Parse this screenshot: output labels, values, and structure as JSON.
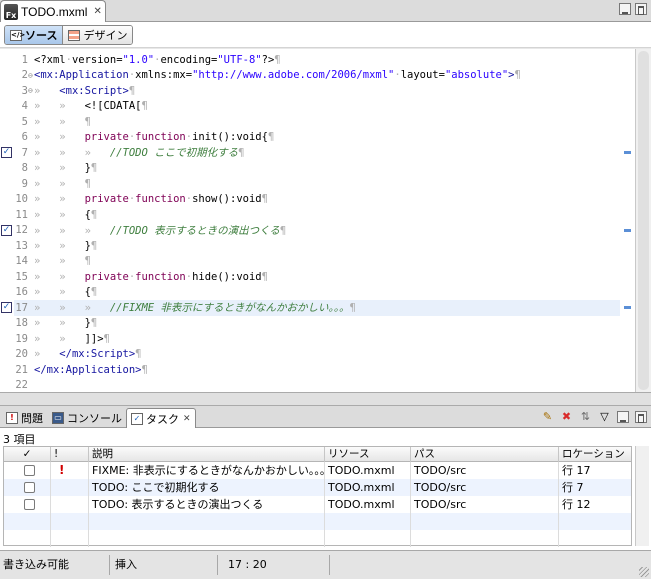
{
  "editor_tab": {
    "title": "TODO.mxml",
    "icon": "flex-file-icon"
  },
  "mode_bar": {
    "source_label": "ソース",
    "design_label": "デザイン",
    "active": "source"
  },
  "code_lines": [
    {
      "n": "1",
      "fold": "",
      "html": "<span class=\"pl\">&lt;?xml</span><span class=\"ws\">·</span><span class=\"pl\">version=</span><span class=\"str\">\"1.0\"</span><span class=\"ws\">·</span><span class=\"pl\">encoding=</span><span class=\"str\">\"UTF-8\"</span><span class=\"pl\">?&gt;</span><span class=\"ws\">¶</span>"
    },
    {
      "n": "2",
      "fold": "⊖",
      "html": "<span class=\"tag\">&lt;mx:Application</span><span class=\"ws\">·</span><span class=\"pl\">xmlns:mx=</span><span class=\"str\">\"http://www.adobe.com/2006/mxml\"</span><span class=\"ws\">·</span><span class=\"pl\">layout=</span><span class=\"str\">\"absolute\"</span><span class=\"tag\">&gt;</span><span class=\"ws\">¶</span>"
    },
    {
      "n": "3",
      "fold": "⊖",
      "html": "<span class=\"ws\">»   </span><span class=\"tag\">&lt;mx:Script&gt;</span><span class=\"ws\">¶</span>"
    },
    {
      "n": "4",
      "fold": "",
      "html": "<span class=\"ws\">»   »   </span><span class=\"pl\">&lt;![CDATA[</span><span class=\"ws\">¶</span>"
    },
    {
      "n": "5",
      "fold": "",
      "html": "<span class=\"ws\">»   »   ¶</span>"
    },
    {
      "n": "6",
      "fold": "",
      "html": "<span class=\"ws\">»   »   </span><span class=\"kw\">private</span><span class=\"ws\">·</span><span class=\"kw\">function</span><span class=\"ws\">·</span><span class=\"pl\">init():void{</span><span class=\"ws\">¶</span>"
    },
    {
      "n": "7",
      "fold": "",
      "html": "<span class=\"ws\">»   »   »   </span><span class=\"cm\">//TODO ここで初期化する</span><span class=\"ws\">¶</span>"
    },
    {
      "n": "8",
      "fold": "",
      "html": "<span class=\"ws\">»   »   </span><span class=\"pl\">}</span><span class=\"ws\">¶</span>"
    },
    {
      "n": "9",
      "fold": "",
      "html": "<span class=\"ws\">»   »   ¶</span>"
    },
    {
      "n": "10",
      "fold": "",
      "html": "<span class=\"ws\">»   »   </span><span class=\"kw\">private</span><span class=\"ws\">·</span><span class=\"kw\">function</span><span class=\"ws\">·</span><span class=\"pl\">show():void</span><span class=\"ws\">¶</span>"
    },
    {
      "n": "11",
      "fold": "",
      "html": "<span class=\"ws\">»   »   </span><span class=\"pl\">{</span><span class=\"ws\">¶</span>"
    },
    {
      "n": "12",
      "fold": "",
      "html": "<span class=\"ws\">»   »   »   </span><span class=\"cm\">//TODO 表示するときの演出つくる</span><span class=\"ws\">¶</span>"
    },
    {
      "n": "13",
      "fold": "",
      "html": "<span class=\"ws\">»   »   </span><span class=\"pl\">}</span><span class=\"ws\">¶</span>"
    },
    {
      "n": "14",
      "fold": "",
      "html": "<span class=\"ws\">»   »   ¶</span>"
    },
    {
      "n": "15",
      "fold": "",
      "html": "<span class=\"ws\">»   »   </span><span class=\"kw\">private</span><span class=\"ws\">·</span><span class=\"kw\">function</span><span class=\"ws\">·</span><span class=\"pl\">hide():void</span><span class=\"ws\">¶</span>"
    },
    {
      "n": "16",
      "fold": "",
      "html": "<span class=\"ws\">»   »   </span><span class=\"pl\">{</span><span class=\"ws\">¶</span>"
    },
    {
      "n": "17",
      "fold": "",
      "html": "<span class=\"ws\">»   »   »   </span><span class=\"cm\">//FIXME 非表示にするときがなんかおかしい。。。</span><span class=\"ws\">¶</span>"
    },
    {
      "n": "18",
      "fold": "",
      "html": "<span class=\"ws\">»   »   </span><span class=\"pl\">}</span><span class=\"ws\">¶</span>"
    },
    {
      "n": "19",
      "fold": "",
      "html": "<span class=\"ws\">»   »   </span><span class=\"pl\">]]&gt;</span><span class=\"ws\">¶</span>"
    },
    {
      "n": "20",
      "fold": "",
      "html": "<span class=\"ws\">»   </span><span class=\"tag\">&lt;/mx:Script&gt;</span><span class=\"ws\">¶</span>"
    },
    {
      "n": "21",
      "fold": "",
      "html": "<span class=\"tag\">&lt;/mx:Application&gt;</span><span class=\"ws\">¶</span>"
    },
    {
      "n": "22",
      "fold": "",
      "html": ""
    }
  ],
  "highlighted_line": "17",
  "task_marker_lines": [
    "7",
    "12",
    "17"
  ],
  "view_tabs": [
    {
      "label": "問題",
      "icon": "problems-icon"
    },
    {
      "label": "コンソール",
      "icon": "console-icon"
    },
    {
      "label": "タスク",
      "icon": "tasks-icon",
      "active": true
    }
  ],
  "tasks": {
    "count_label": "3 項目",
    "columns": [
      "✓",
      "!",
      "説明",
      "リソース",
      "パス",
      "ロケーション"
    ],
    "rows": [
      {
        "done": false,
        "priority": "!",
        "description": "FIXME: 非表示にするときがなんかおかしい。。。",
        "resource": "TODO.mxml",
        "path": "TODO/src",
        "location": "行 17"
      },
      {
        "done": false,
        "priority": "",
        "description": "TODO: ここで初期化する",
        "resource": "TODO.mxml",
        "path": "TODO/src",
        "location": "行 7"
      },
      {
        "done": false,
        "priority": "",
        "description": "TODO: 表示するときの演出つくる",
        "resource": "TODO.mxml",
        "path": "TODO/src",
        "location": "行 12"
      }
    ]
  },
  "statusbar": {
    "writable": "書き込み可能",
    "insert_mode": "挿入",
    "position": "17 : 20"
  }
}
